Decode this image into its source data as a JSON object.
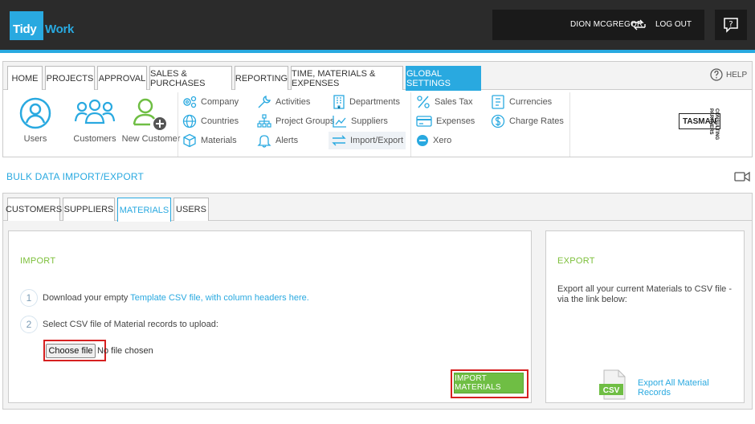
{
  "app": {
    "logo_word1": "Tidy",
    "logo_word2": "Work",
    "user_name": "DION MCGREGOR",
    "logout_label": "LOG OUT",
    "help_glyph": "?"
  },
  "main_tabs": [
    {
      "label": "HOME",
      "active": false
    },
    {
      "label": "PROJECTS",
      "active": false
    },
    {
      "label": "APPROVAL",
      "active": false
    },
    {
      "label": "SALES & PURCHASES",
      "active": false
    },
    {
      "label": "REPORTING",
      "active": false
    },
    {
      "label": "TIME, MATERIALS & EXPENSES",
      "active": false
    },
    {
      "label": "GLOBAL SETTINGS",
      "active": true
    }
  ],
  "help_label": "HELP",
  "settings_large": [
    {
      "label": "Users",
      "icon": "user-circle-icon"
    },
    {
      "label": "Customers",
      "icon": "customers-group-icon"
    },
    {
      "label": "New Customer",
      "icon": "add-customer-icon"
    }
  ],
  "settings_col1": [
    {
      "label": "Company",
      "icon": "gears-icon"
    },
    {
      "label": "Countries",
      "icon": "globe-icon"
    },
    {
      "label": "Materials",
      "icon": "cube-icon"
    }
  ],
  "settings_col2": [
    {
      "label": "Activities",
      "icon": "wrench-icon"
    },
    {
      "label": "Project Groups",
      "icon": "sitemap-icon"
    },
    {
      "label": "Alerts",
      "icon": "bell-icon"
    }
  ],
  "settings_col3": [
    {
      "label": "Departments",
      "icon": "building-icon"
    },
    {
      "label": "Suppliers",
      "icon": "chart-icon"
    },
    {
      "label": "Import/Export",
      "icon": "swap-arrows-icon",
      "selected": true
    }
  ],
  "settings_col4": [
    {
      "label": "Sales Tax",
      "icon": "percent-icon"
    },
    {
      "label": "Expenses",
      "icon": "credit-card-icon"
    },
    {
      "label": "Xero",
      "icon": "xero-icon"
    }
  ],
  "settings_col5": [
    {
      "label": "Currencies",
      "icon": "currency-icon"
    },
    {
      "label": "Charge Rates",
      "icon": "dollar-circle-icon"
    }
  ],
  "partner": {
    "name": "TASMAN",
    "sub": "CONSULTING PARTNERS"
  },
  "page": {
    "title": "BULK DATA IMPORT/EXPORT"
  },
  "sub_tabs": [
    {
      "label": "CUSTOMERS",
      "active": false
    },
    {
      "label": "SUPPLIERS",
      "active": false
    },
    {
      "label": "MATERIALS",
      "active": true
    },
    {
      "label": "USERS",
      "active": false
    }
  ],
  "import": {
    "title": "IMPORT",
    "step1_num": "1",
    "step1_text": "Download your empty ",
    "step1_link": "Template CSV file, with column headers here.",
    "step2_num": "2",
    "step2_text": "Select CSV file of Material records to upload:",
    "choose_label": "Choose file",
    "no_file": "No file chosen",
    "button_label": "IMPORT MATERIALS"
  },
  "export": {
    "title": "EXPORT",
    "text": "Export all your current Materials to CSV file - via the link below:",
    "csv_label": "CSV",
    "link_label": "Export All Material Records"
  },
  "colors": {
    "accent": "#29a9e0",
    "green": "#6fbe44",
    "highlight_red": "#d62020"
  }
}
